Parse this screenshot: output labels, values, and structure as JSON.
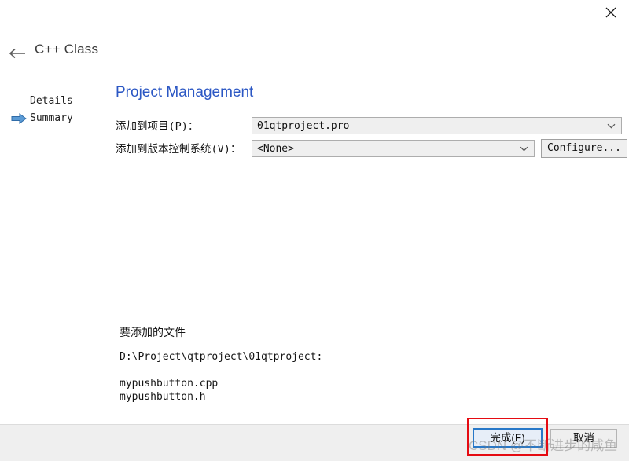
{
  "window": {
    "close_icon": "close-icon"
  },
  "wizard": {
    "back_icon": "arrow-left-icon",
    "title": "C++ Class",
    "steps": [
      {
        "label": "Details",
        "active": false,
        "marker_icon": ""
      },
      {
        "label": "Summary",
        "active": true,
        "marker_icon": "arrow-right-blue-icon"
      }
    ]
  },
  "panel": {
    "title": "Project Management",
    "fields": [
      {
        "label": "添加到项目(P)：",
        "value": "01qtproject.pro",
        "arrow_icon": "chevron-down-icon"
      },
      {
        "label": "添加到版本控制系统(V)：",
        "value": "<None>",
        "arrow_icon": "chevron-down-icon",
        "button_label": "Configure..."
      }
    ]
  },
  "files": {
    "heading": "要添加的文件",
    "path": "D:\\Project\\qtproject\\01qtproject:",
    "items": [
      "mypushbutton.cpp",
      "mypushbutton.h"
    ]
  },
  "footer": {
    "finish_label": "完成(F)",
    "cancel_label": "取消"
  },
  "overlay": {
    "watermark": "CSDN @不断进步的咸鱼",
    "annotation_color": "#e50b12",
    "focus_color": "#2878c8",
    "accent_color": "#2b57c4"
  }
}
